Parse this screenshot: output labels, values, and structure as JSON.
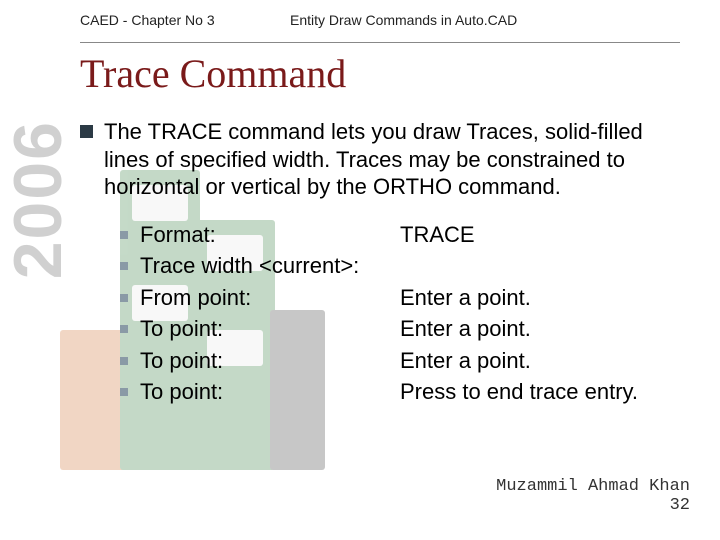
{
  "header": {
    "chapter": "CAED - Chapter No 3",
    "subtitle": "Entity Draw Commands in Auto.CAD"
  },
  "title": "Trace Command",
  "side_year": "2006",
  "main_text": "The TRACE command lets you draw Traces, solid-filled lines of specified width. Traces may be constrained to horizontal or vertical by the ORTHO command.",
  "sub_items": [
    {
      "left": "Format:",
      "right": "TRACE"
    },
    {
      "left": "Trace width <current>:",
      "right": ""
    },
    {
      "left": "From point:",
      "right": "Enter a point."
    },
    {
      "left": "To point:",
      "right": "Enter a point."
    },
    {
      "left": "To point:",
      "right": "Enter a point."
    },
    {
      "left": "To point:",
      "right": "Press  to end trace entry."
    }
  ],
  "footer": {
    "author": "Muzammil Ahmad Khan",
    "page": "32"
  }
}
